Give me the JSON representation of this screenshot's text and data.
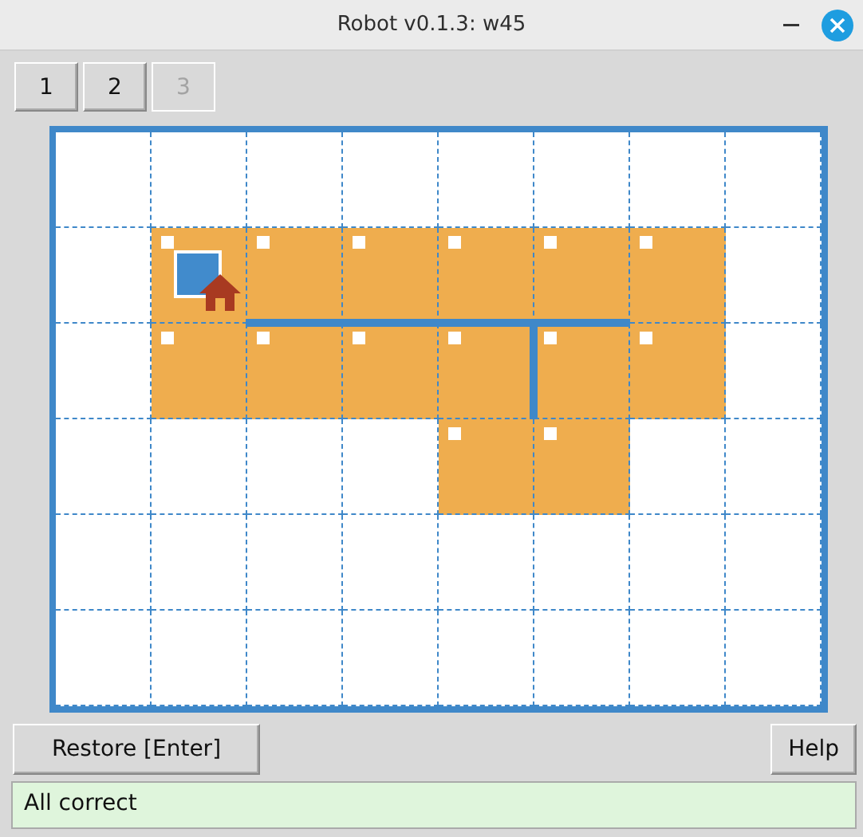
{
  "window": {
    "title": "Robot v0.1.3: w45"
  },
  "tabs": [
    {
      "label": "1",
      "disabled": false
    },
    {
      "label": "2",
      "disabled": false
    },
    {
      "label": "3",
      "disabled": true
    }
  ],
  "board": {
    "rows": [
      {
        "cells": [
          {
            "painted": false
          },
          {
            "painted": false
          },
          {
            "painted": false
          },
          {
            "painted": false
          },
          {
            "painted": false
          },
          {
            "painted": false
          },
          {
            "painted": false
          },
          {
            "painted": false
          }
        ]
      },
      {
        "cells": [
          {
            "painted": false
          },
          {
            "painted": true,
            "marked": true,
            "robot": true,
            "home": true
          },
          {
            "painted": true,
            "marked": true,
            "wall_below": true
          },
          {
            "painted": true,
            "marked": true,
            "wall_below": true
          },
          {
            "painted": true,
            "marked": true,
            "wall_below": true
          },
          {
            "painted": true,
            "marked": true,
            "wall_below": true
          },
          {
            "painted": true,
            "marked": true
          },
          {
            "painted": false
          }
        ]
      },
      {
        "cells": [
          {
            "painted": false
          },
          {
            "painted": true,
            "marked": true
          },
          {
            "painted": true,
            "marked": true
          },
          {
            "painted": true,
            "marked": true
          },
          {
            "painted": true,
            "marked": true,
            "wall_right": true
          },
          {
            "painted": true,
            "marked": true
          },
          {
            "painted": true,
            "marked": true
          },
          {
            "painted": false
          }
        ]
      },
      {
        "cells": [
          {
            "painted": false
          },
          {
            "painted": false
          },
          {
            "painted": false
          },
          {
            "painted": false
          },
          {
            "painted": true,
            "marked": true
          },
          {
            "painted": true,
            "marked": true
          },
          {
            "painted": false
          },
          {
            "painted": false
          }
        ]
      },
      {
        "cells": [
          {
            "painted": false
          },
          {
            "painted": false
          },
          {
            "painted": false
          },
          {
            "painted": false
          },
          {
            "painted": false
          },
          {
            "painted": false
          },
          {
            "painted": false
          },
          {
            "painted": false
          }
        ]
      },
      {
        "cells": [
          {
            "painted": false
          },
          {
            "painted": false
          },
          {
            "painted": false
          },
          {
            "painted": false
          },
          {
            "painted": false
          },
          {
            "painted": false
          },
          {
            "painted": false
          },
          {
            "painted": false
          }
        ]
      }
    ]
  },
  "buttons": {
    "restore": "Restore [Enter]",
    "help": "Help"
  },
  "status": "All correct"
}
